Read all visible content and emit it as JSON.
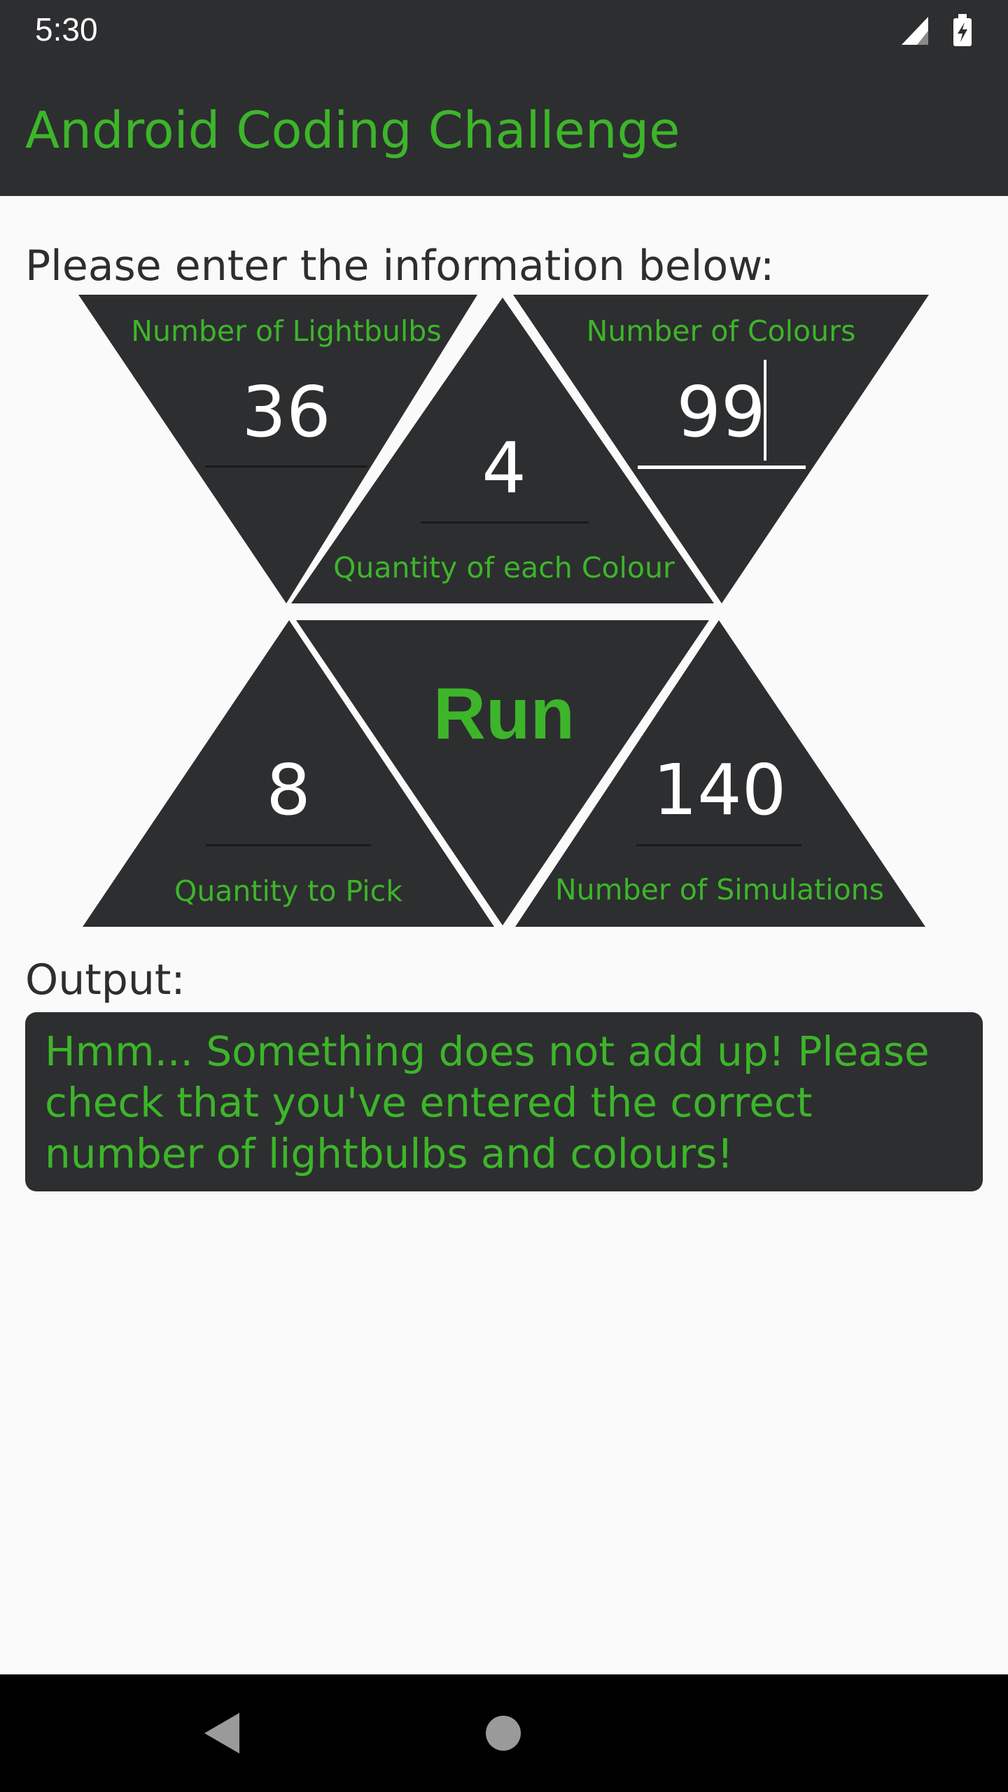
{
  "status_bar": {
    "time": "5:30",
    "icons": [
      "signal-icon",
      "battery-charging-icon"
    ]
  },
  "app_bar": {
    "title": "Android Coding Challenge"
  },
  "form": {
    "prompt": "Please enter the information below:",
    "lightbulbs": {
      "label": "Number of Lightbulbs",
      "value": "36"
    },
    "colours": {
      "label": "Number of Colours",
      "value": "99"
    },
    "quantity_each": {
      "label": "Quantity of each Colour",
      "value": "4"
    },
    "quantity_pick": {
      "label": "Quantity to Pick",
      "value": "8"
    },
    "simulations": {
      "label": "Number of Simulations",
      "value": "140"
    },
    "run_label": "Run"
  },
  "output": {
    "heading": "Output:",
    "text": "Hmm... Something does not add up! Please check that you've entered the correct number of lightbulbs and colours!"
  },
  "nav_bar": {
    "icons": [
      "back-icon",
      "home-icon"
    ]
  },
  "colors": {
    "accent": "#3db52a",
    "panel": "#2d2e30",
    "background": "#fafafa"
  }
}
